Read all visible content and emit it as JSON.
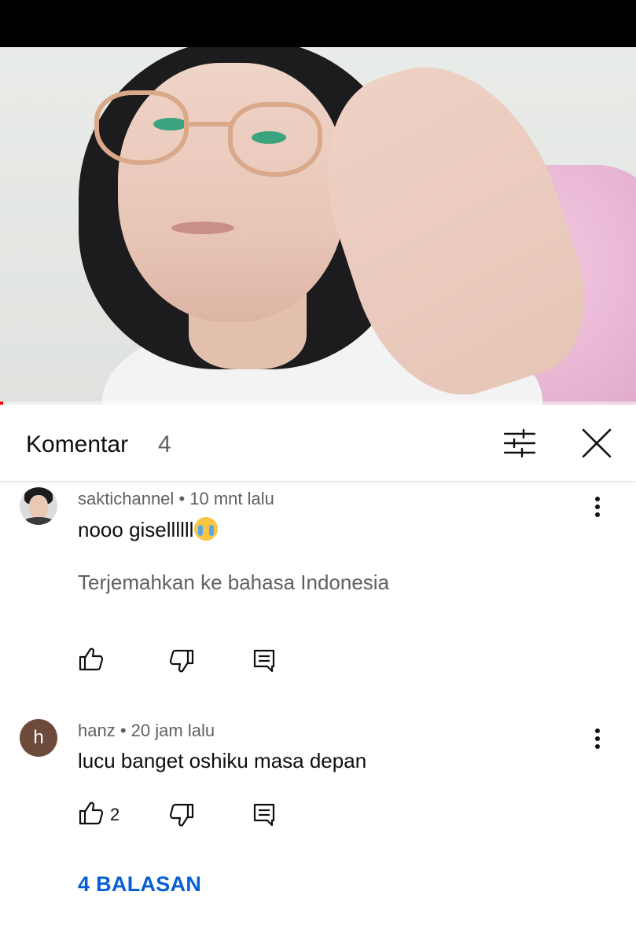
{
  "header": {
    "title": "Komentar",
    "count": "4"
  },
  "comments": [
    {
      "author": "saktichannel",
      "time": "10 mnt lalu",
      "text": "nooo gisellllll",
      "emoji": "loudly-crying-face",
      "translate_label": "Terjemahkan ke bahasa Indonesia",
      "likes": ""
    },
    {
      "author": "hanz",
      "avatar_letter": "h",
      "time": "20 jam lalu",
      "text": "lucu banget oshiku masa depan",
      "likes": "2",
      "replies_label": "4 BALASAN"
    }
  ],
  "colors": {
    "link": "#065fd4",
    "secondary_text": "#606060",
    "primary_text": "#0f0f0f",
    "avatar_letter_bg": "#6e4a3a"
  }
}
